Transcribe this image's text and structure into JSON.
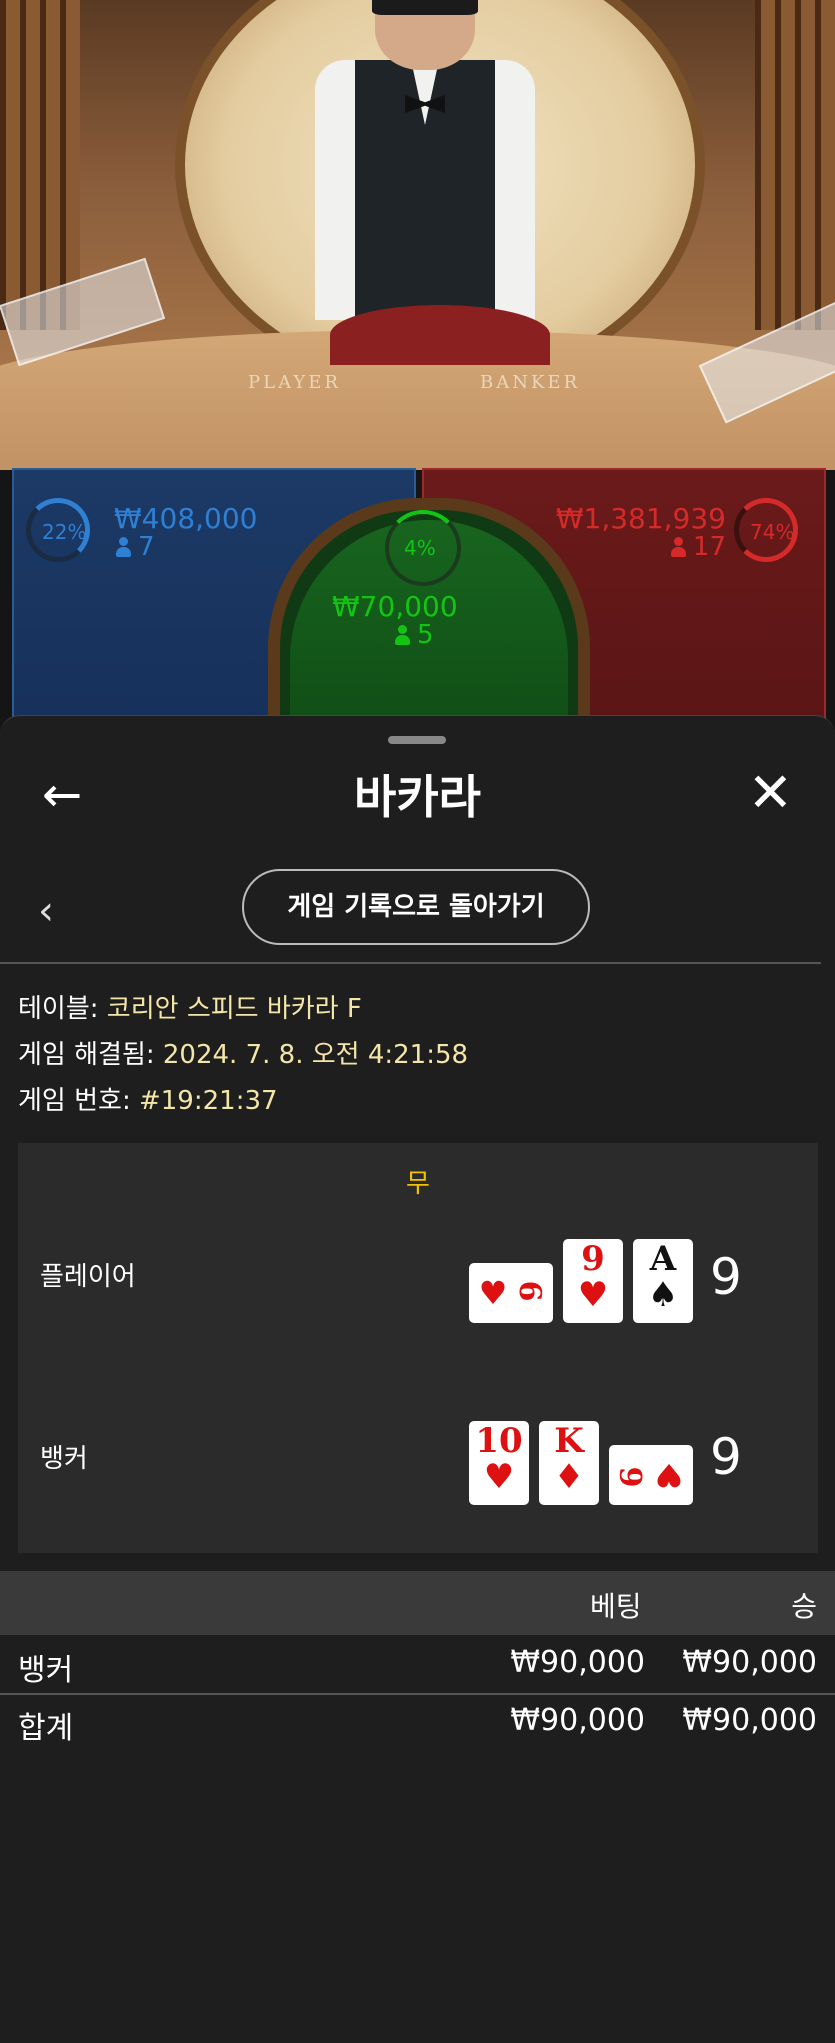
{
  "video": {
    "player_label": "PLAYER",
    "banker_label": "BANKER"
  },
  "bets": {
    "player": {
      "pct": "22%",
      "amount": "₩408,000",
      "count": "7"
    },
    "tie": {
      "pct": "4%",
      "amount": "₩70,000",
      "count": "5"
    },
    "banker": {
      "pct": "74%",
      "amount": "₩1,381,939",
      "count": "17"
    }
  },
  "colors": {
    "player": "#2f7fd3",
    "banker": "#d42a2a",
    "tie": "#14c414",
    "result": "#f2c200",
    "meta_value": "#f4e6a8"
  },
  "sheet": {
    "title": "바카라",
    "back_icon": "arrow-left-icon",
    "close_icon": "close-icon",
    "history_button": "게임 기록으로 돌아가기",
    "meta": [
      {
        "label": "테이블:",
        "value": "코리안 스피드 바카라 F"
      },
      {
        "label": "게임 해결됨:",
        "value": "2024. 7. 8. 오전 4:21:58"
      },
      {
        "label": "게임 번호:",
        "value": "#19:21:37"
      }
    ],
    "result": {
      "outcome": "무",
      "player": {
        "label": "플레이어",
        "score": "9",
        "cards": [
          {
            "rank": "6",
            "suit": "♥"
          },
          {
            "rank": "9",
            "suit": "♥"
          },
          {
            "rank": "A",
            "suit": "♠"
          }
        ]
      },
      "banker": {
        "label": "뱅커",
        "score": "9",
        "cards": [
          {
            "rank": "10",
            "suit": "♥"
          },
          {
            "rank": "K",
            "suit": "♦"
          },
          {
            "rank": "6",
            "suit": "♥"
          }
        ]
      }
    },
    "bet_table": {
      "headers": {
        "bet": "베팅",
        "win": "승"
      },
      "rows": [
        {
          "name": "뱅커",
          "bet": "₩90,000",
          "win": "₩90,000"
        }
      ],
      "total": {
        "name": "합계",
        "bet": "₩90,000",
        "win": "₩90,000"
      }
    }
  }
}
